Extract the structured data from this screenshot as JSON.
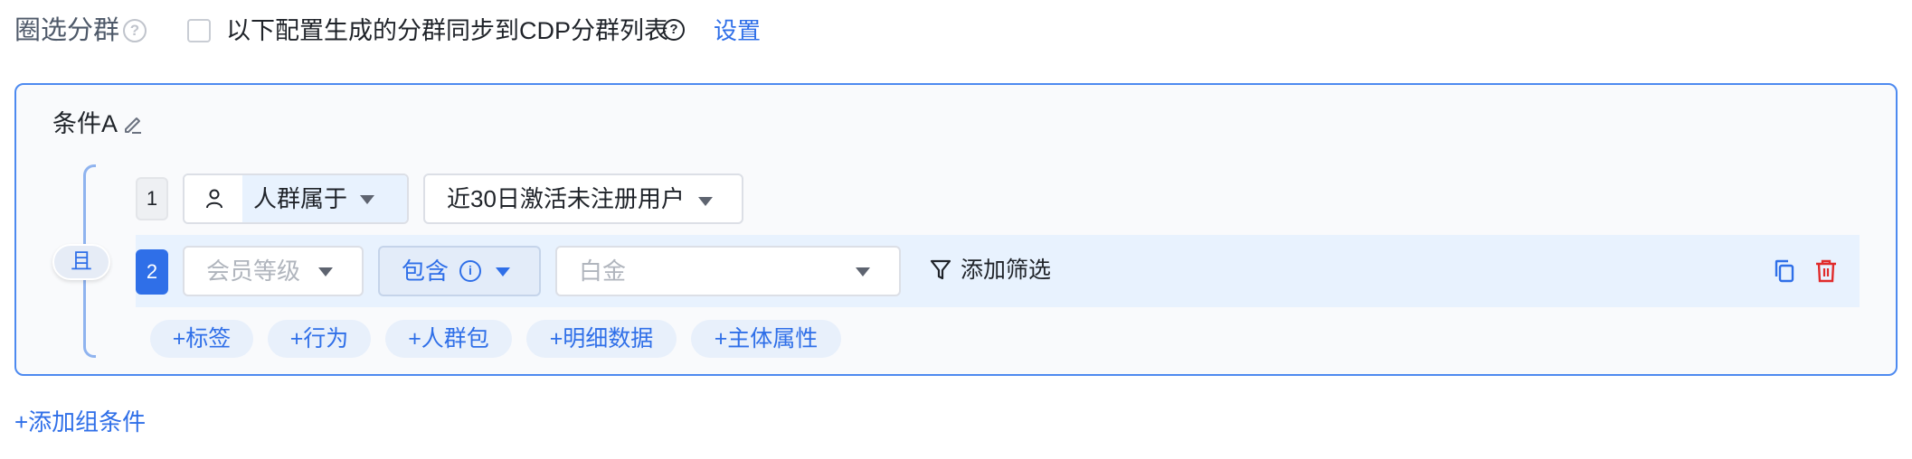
{
  "header": {
    "title": "圈选分群",
    "help_icon": "question-circle-icon",
    "sync_checkbox_checked": false,
    "sync_label": "以下配置生成的分群同步到CDP分群列表",
    "settings_link": "设置"
  },
  "group": {
    "title": "条件A",
    "logic_label": "且",
    "rows": [
      {
        "index": "1",
        "field_label": "人群属于",
        "value_label": "近30日激活未注册用户"
      },
      {
        "index": "2",
        "field_placeholder": "会员等级",
        "operator_label": "包含",
        "value_placeholder": "白金",
        "add_filter_label": "添加筛选"
      }
    ],
    "add_buttons": [
      "+标签",
      "+行为",
      "+人群包",
      "+明细数据",
      "+主体属性"
    ]
  },
  "footer": {
    "add_group_label": "+添加组条件"
  },
  "colors": {
    "accent": "#2f6fe8",
    "card_border": "#4d8af0",
    "row_highlight": "#e8f2fe",
    "delete": "#e02b2b"
  }
}
